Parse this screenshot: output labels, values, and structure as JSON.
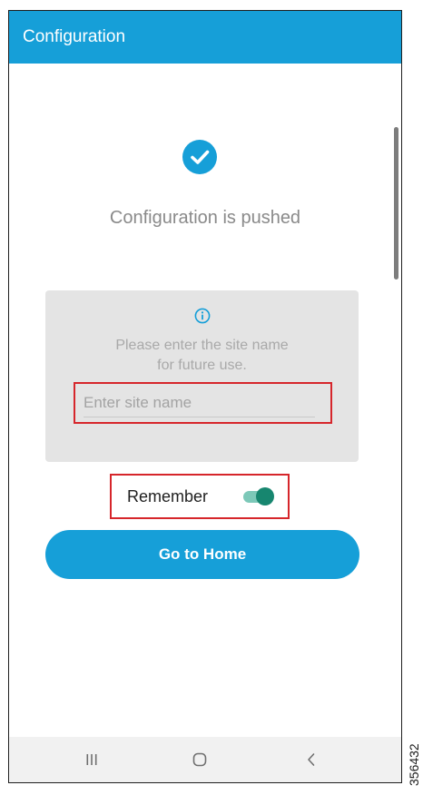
{
  "app_bar": {
    "title": "Configuration",
    "color": "#169fd8"
  },
  "status": {
    "icon": "check-circle-icon",
    "message": "Configuration is pushed"
  },
  "info_card": {
    "icon": "info-icon",
    "line1": "Please enter the site name",
    "line2": "for future use.",
    "site_input": {
      "value": "",
      "placeholder": "Enter site name"
    }
  },
  "remember": {
    "label": "Remember",
    "toggle_on": true,
    "toggle_color": "#17866f"
  },
  "home_button": {
    "label": "Go to Home"
  },
  "nav_bar": {
    "recents_icon": "recents-icon",
    "home_icon": "home-icon",
    "back_icon": "back-icon"
  },
  "figure_number": "356432",
  "highlight_color": "#d6262b"
}
